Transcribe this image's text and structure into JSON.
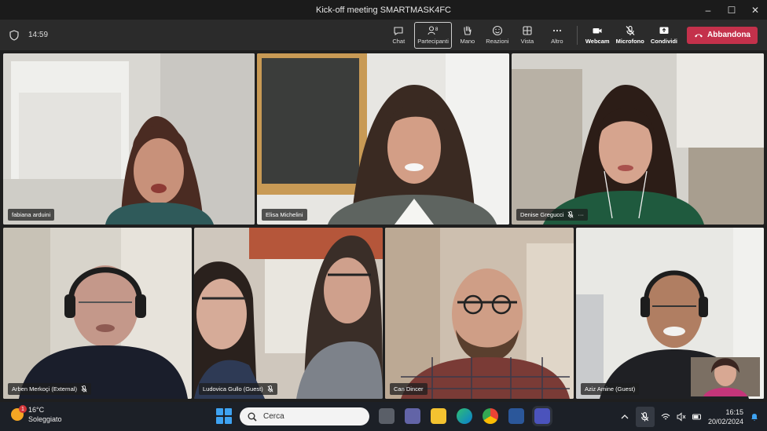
{
  "window": {
    "title": "Kick-off meeting SMARTMASK4FC",
    "controls": [
      "–",
      "☐",
      "✕"
    ]
  },
  "toolbar": {
    "time": "14:59",
    "buttons": [
      {
        "label": "Chat",
        "icon": "chat-icon"
      },
      {
        "label": "Partecipanti",
        "icon": "participants-icon",
        "count": "8"
      },
      {
        "label": "Mano",
        "icon": "raise-hand-icon"
      },
      {
        "label": "Reazioni",
        "icon": "reactions-icon"
      },
      {
        "label": "Vista",
        "icon": "view-icon"
      },
      {
        "label": "Altro",
        "icon": "more-icon"
      },
      {
        "label": "Webcam",
        "icon": "camera-icon"
      },
      {
        "label": "Microfono",
        "icon": "mic-off-icon"
      },
      {
        "label": "Condividi",
        "icon": "share-icon"
      }
    ],
    "leave_label": "Abbandona"
  },
  "participants": [
    {
      "name": "fabiana arduini",
      "muted": false,
      "speaking": true
    },
    {
      "name": "Elisa Michelini",
      "muted": false,
      "speaking": false
    },
    {
      "name": "Denise Gregucci",
      "muted": true,
      "speaking": false,
      "more": "···"
    },
    {
      "name": "Arben Merkoçi (External)",
      "muted": true,
      "speaking": false
    },
    {
      "name": "Ludovica Gullo (Guest)",
      "muted": true,
      "speaking": false
    },
    {
      "name": "Can Dincer",
      "muted": false,
      "speaking": true
    },
    {
      "name": "Aziz Amine (Guest)",
      "muted": false,
      "speaking": true
    }
  ],
  "taskbar": {
    "weather_temp": "16°C",
    "weather_desc": "Soleggiato",
    "weather_badge": "1",
    "search_placeholder": "Cerca",
    "clock_time": "16:15",
    "clock_date": "20/02/2024"
  },
  "colors": {
    "leave": "#c4314b",
    "speaking": "#8e8fe6",
    "accent": "#3ea3f2"
  }
}
